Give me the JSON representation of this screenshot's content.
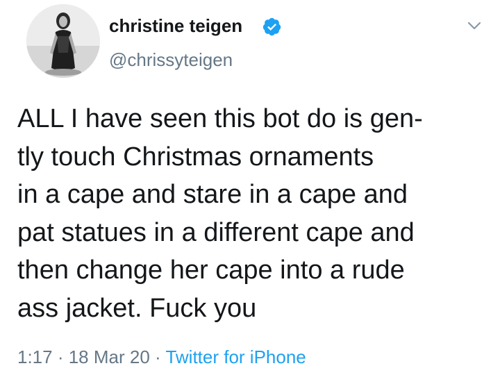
{
  "author": {
    "display_name": "christine teigen",
    "handle": "@chrissyteigen",
    "verified_icon": "verified-badge-icon",
    "avatar_icon": "profile-photo"
  },
  "menu": {
    "icon": "chevron-down-icon"
  },
  "tweet": {
    "lines": [
      "ALL I have seen this bot do is gen-",
      "tly touch Christmas ornaments",
      "in a cape and stare in a cape and",
      "pat statues in a different cape and",
      "then change her cape into a rude",
      "ass jacket. Fuck you"
    ]
  },
  "meta": {
    "time": "1:17",
    "separator": " · ",
    "date": "18 Mar 20",
    "source": "Twitter for iPhone"
  },
  "colors": {
    "text": "#14171a",
    "secondary": "#657786",
    "link": "#1da1f2",
    "verified": "#1da1f2"
  }
}
